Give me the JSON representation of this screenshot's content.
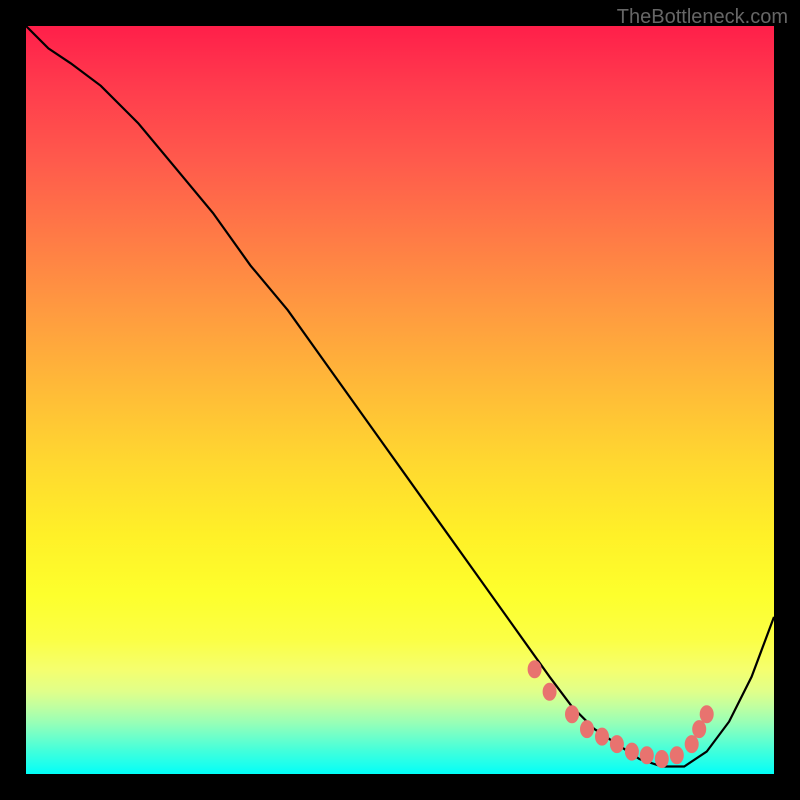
{
  "watermark": "TheBottleneck.com",
  "chart_data": {
    "type": "line",
    "title": "",
    "xlabel": "",
    "ylabel": "",
    "xlim": [
      0,
      100
    ],
    "ylim": [
      0,
      100
    ],
    "series": [
      {
        "name": "curve",
        "x": [
          0,
          3,
          6,
          10,
          15,
          20,
          25,
          30,
          35,
          40,
          45,
          50,
          55,
          60,
          65,
          70,
          73,
          76,
          79,
          82,
          85,
          88,
          91,
          94,
          97,
          100
        ],
        "y": [
          100,
          97,
          95,
          92,
          87,
          81,
          75,
          68,
          62,
          55,
          48,
          41,
          34,
          27,
          20,
          13,
          9,
          6,
          4,
          2,
          1,
          1,
          3,
          7,
          13,
          21
        ]
      }
    ],
    "markers": {
      "name": "highlight-dots",
      "color": "#e8736f",
      "points": [
        {
          "x": 68,
          "y": 14
        },
        {
          "x": 70,
          "y": 11
        },
        {
          "x": 73,
          "y": 8
        },
        {
          "x": 75,
          "y": 6
        },
        {
          "x": 77,
          "y": 5
        },
        {
          "x": 79,
          "y": 4
        },
        {
          "x": 81,
          "y": 3
        },
        {
          "x": 83,
          "y": 2.5
        },
        {
          "x": 85,
          "y": 2
        },
        {
          "x": 87,
          "y": 2.5
        },
        {
          "x": 89,
          "y": 4
        },
        {
          "x": 90,
          "y": 6
        },
        {
          "x": 91,
          "y": 8
        }
      ]
    },
    "background_gradient": {
      "top": "#ff1f4a",
      "middle": "#ffd730",
      "bottom": "#00fff8"
    }
  }
}
